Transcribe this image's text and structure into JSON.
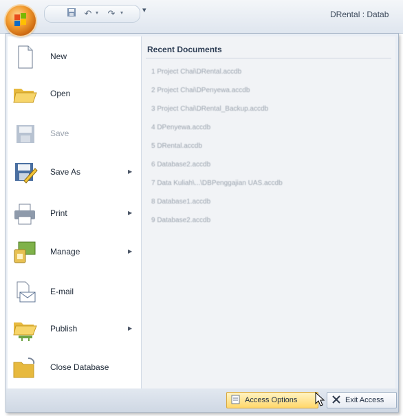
{
  "window": {
    "title": "DRental : Datab"
  },
  "qat": {
    "customize_glyph": "▾"
  },
  "menu": {
    "commands": [
      {
        "label": "New",
        "icon": "new-document-icon",
        "has_arrow": false,
        "enabled": true
      },
      {
        "label": "Open",
        "icon": "open-folder-icon",
        "has_arrow": false,
        "enabled": true
      },
      {
        "label": "Save",
        "icon": "save-icon",
        "has_arrow": false,
        "enabled": false
      },
      {
        "label": "Save As",
        "icon": "save-as-icon",
        "has_arrow": true,
        "enabled": true
      },
      {
        "label": "Print",
        "icon": "printer-icon",
        "has_arrow": true,
        "enabled": true
      },
      {
        "label": "Manage",
        "icon": "manage-icon",
        "has_arrow": true,
        "enabled": true
      },
      {
        "label": "E-mail",
        "icon": "email-icon",
        "has_arrow": false,
        "enabled": true
      },
      {
        "label": "Publish",
        "icon": "publish-icon",
        "has_arrow": true,
        "enabled": true
      },
      {
        "label": "Close Database",
        "icon": "close-database-icon",
        "has_arrow": false,
        "enabled": true
      }
    ],
    "submenu_arrow": "▶",
    "recent": {
      "title": "Recent Documents",
      "items": [
        "1 Project Chai\\DRental.accdb",
        "2 Project Chai\\DPenyewa.accdb",
        "3 Project Chai\\DRental_Backup.accdb",
        "4 DPenyewa.accdb",
        "5 DRental.accdb",
        "6 Database2.accdb",
        "7 Data Kuliah\\...\\DBPenggajian UAS.accdb",
        "8 Database1.accdb",
        "9 Database2.accdb"
      ]
    },
    "footer": {
      "options_label": "Access Options",
      "exit_label": "Exit Access"
    }
  },
  "colors": {
    "accent": "#f29c2f",
    "hover": "#ffd76b"
  }
}
